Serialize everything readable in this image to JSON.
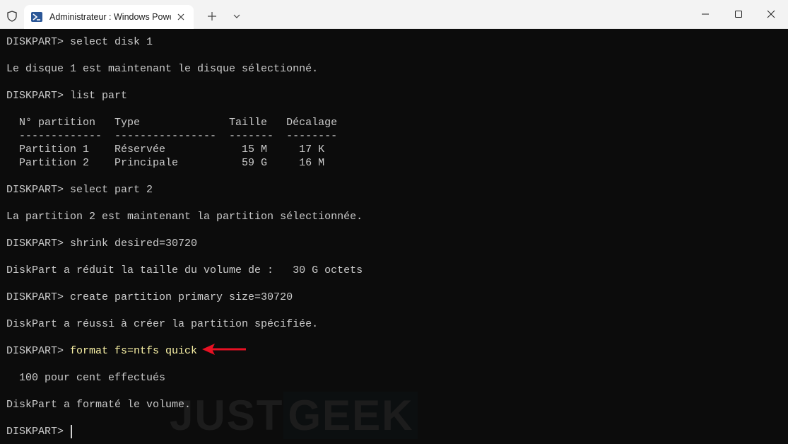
{
  "tab": {
    "title": "Administrateur : Windows PowerShell"
  },
  "icons": {
    "shield": "shield-icon",
    "powershell": "powershell-icon",
    "close_tab": "close-icon",
    "new_tab": "plus-icon",
    "dropdown": "chevron-down-icon",
    "minimize": "minimize-icon",
    "maximize": "maximize-icon",
    "close_window": "close-icon"
  },
  "colors": {
    "terminal_bg": "#0c0c0c",
    "text": "#cccccc",
    "highlight": "#f9f1a5",
    "arrow": "#e81123"
  },
  "terminal": {
    "lines": [
      "DISKPART> select disk 1",
      "",
      "Le disque 1 est maintenant le disque sélectionné.",
      "",
      "DISKPART> list part",
      "",
      "  N° partition   Type              Taille   Décalage",
      "  -------------  ----------------  -------  --------",
      "  Partition 1    Réservée            15 M     17 K",
      "  Partition 2    Principale          59 G     16 M",
      "",
      "DISKPART> select part 2",
      "",
      "La partition 2 est maintenant la partition sélectionnée.",
      "",
      "DISKPART> shrink desired=30720",
      "",
      "DiskPart a réduit la taille du volume de :   30 G octets",
      "",
      "DISKPART> create partition primary size=30720",
      "",
      "DiskPart a réussi à créer la partition spécifiée.",
      "",
      "",
      "",
      "  100 pour cent effectués",
      "",
      "DiskPart a formaté le volume.",
      "",
      ""
    ],
    "format_prompt": "DISKPART> ",
    "format_command": "format fs=ntfs quick",
    "final_prompt": "DISKPART> "
  },
  "watermark": {
    "part1": "JUST",
    "part2": "GEEK"
  }
}
